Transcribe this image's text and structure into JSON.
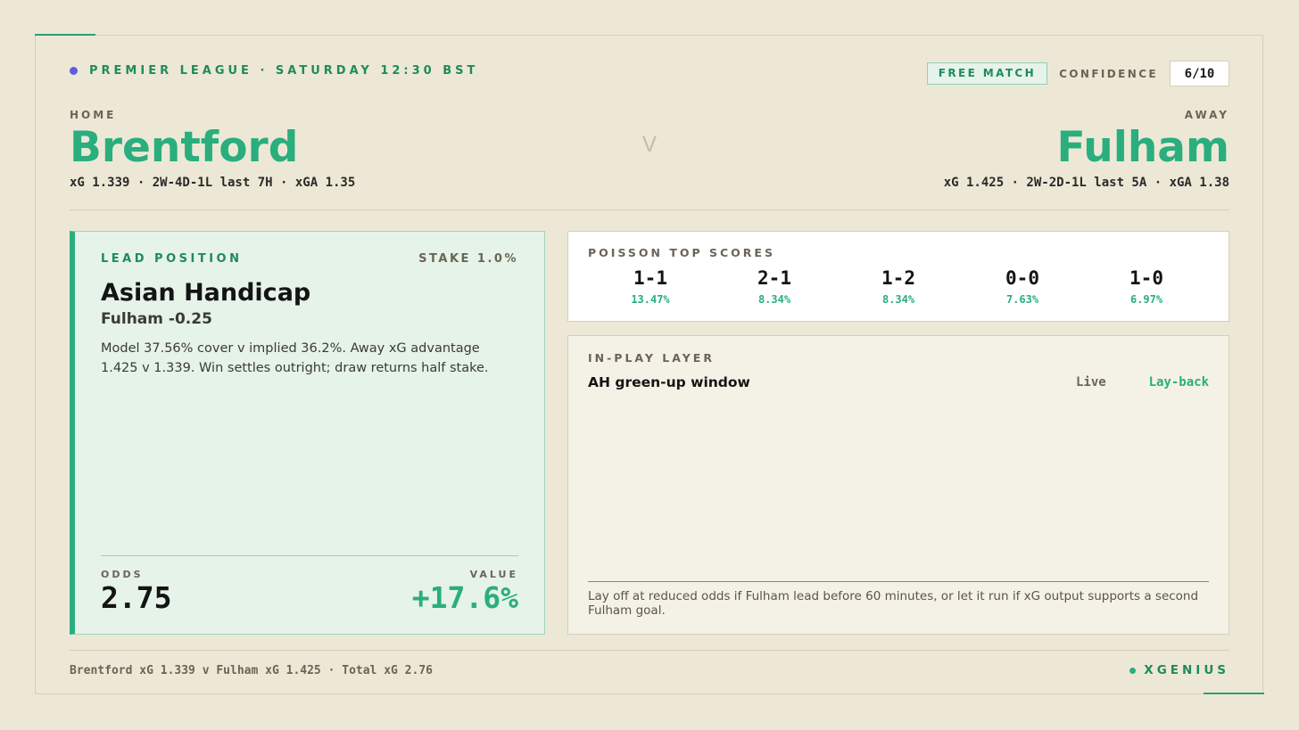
{
  "header": {
    "league_line": "PREMIER LEAGUE · SATURDAY 12:30 BST",
    "badge": "FREE MATCH",
    "confidence_label": "CONFIDENCE",
    "confidence_value": "6/10"
  },
  "home": {
    "label": "HOME",
    "name": "Brentford",
    "stats": "xG 1.339 · 2W-4D-1L last 7H · xGA 1.35"
  },
  "away": {
    "label": "AWAY",
    "name": "Fulham",
    "stats": "xG 1.425 · 2W-2D-1L last 5A · xGA 1.38"
  },
  "vs": "V",
  "lead": {
    "label": "LEAD POSITION",
    "stake": "STAKE 1.0%",
    "market": "Asian Handicap",
    "selection": "Fulham -0.25",
    "description": "Model 37.56% cover v implied 36.2%. Away xG advantage 1.425 v 1.339. Win settles outright; draw returns half stake.",
    "odds_label": "ODDS",
    "odds": "2.75",
    "value_label": "VALUE",
    "value": "+17.6%"
  },
  "poisson": {
    "label": "POISSON TOP SCORES",
    "scores": [
      {
        "score": "1-1",
        "prob": "13.47%"
      },
      {
        "score": "2-1",
        "prob": "8.34%"
      },
      {
        "score": "1-2",
        "prob": "8.34%"
      },
      {
        "score": "0-0",
        "prob": "7.63%"
      },
      {
        "score": "1-0",
        "prob": "6.97%"
      }
    ]
  },
  "inplay": {
    "label": "IN-PLAY LAYER",
    "title": "AH green-up window",
    "status": "Live",
    "action": "Lay-back",
    "note": "Lay off at reduced odds if Fulham lead before 60 minutes, or let it run if xG output supports a second Fulham goal."
  },
  "footer": {
    "summary": "Brentford xG 1.339 v Fulham xG 1.425 · Total xG 2.76",
    "brand": "XGENIUS"
  },
  "colors": {
    "accent": "#2aae7e",
    "accent_dark": "#1f8a5e",
    "background": "#ede8d6",
    "league_dot": "#5b5ee0"
  }
}
